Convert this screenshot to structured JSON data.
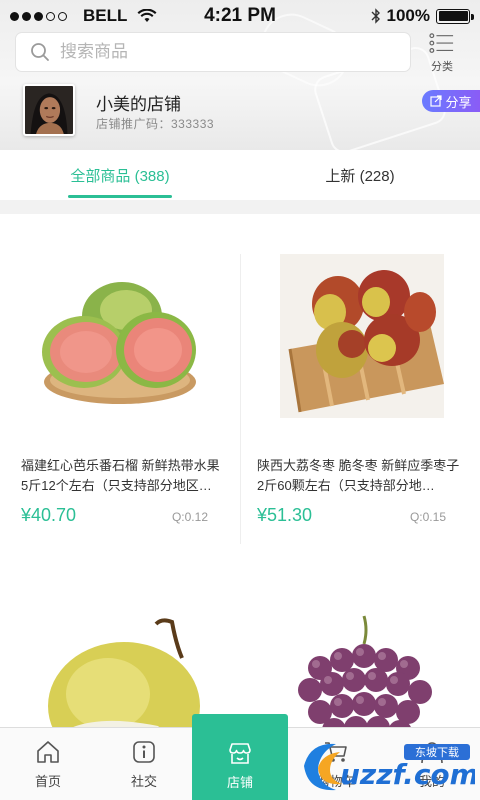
{
  "status_bar": {
    "carrier": "BELL",
    "time": "4:21 PM",
    "battery": "100%",
    "battery_level": 1.0,
    "signal_bars": 3
  },
  "search": {
    "placeholder": "搜索商品"
  },
  "category_button": {
    "label": "分类",
    "icon": "list-icon"
  },
  "shop": {
    "name": "小美的店铺",
    "code_label": "店铺推广码：333333"
  },
  "share_button": {
    "label": "分享",
    "icon": "share-icon"
  },
  "tabs": [
    {
      "label": "全部商品 (388)",
      "active": true
    },
    {
      "label": "上新 (228)",
      "active": false
    }
  ],
  "products": [
    {
      "title": "福建红心芭乐番石榴 新鲜热带水果5斤12个左右（只支持部分地区…",
      "price": "¥40.70",
      "q": "Q:0.12",
      "image": "guava"
    },
    {
      "title": "陕西大荔冬枣 脆冬枣 新鲜应季枣子2斤60颗左右（只支持部分地…",
      "price": "¥51.30",
      "q": "Q:0.15",
      "image": "jujube"
    },
    {
      "title": "",
      "price": "",
      "q": "",
      "image": "pear"
    },
    {
      "title": "",
      "price": "",
      "q": "",
      "image": "grapes"
    }
  ],
  "tabbar": [
    {
      "label": "首页",
      "icon": "home-icon",
      "active": false
    },
    {
      "label": "社交",
      "icon": "info-icon",
      "active": false
    },
    {
      "label": "店铺",
      "icon": "store-icon",
      "active": true
    },
    {
      "label": "购物车",
      "icon": "cart-icon",
      "active": false
    },
    {
      "label": "我的",
      "icon": "user-icon",
      "active": false
    }
  ],
  "watermark": {
    "top": "东坡下载",
    "main": "uzzf.com"
  },
  "colors": {
    "accent": "#2bbf95",
    "share": "#7a6cf9"
  }
}
